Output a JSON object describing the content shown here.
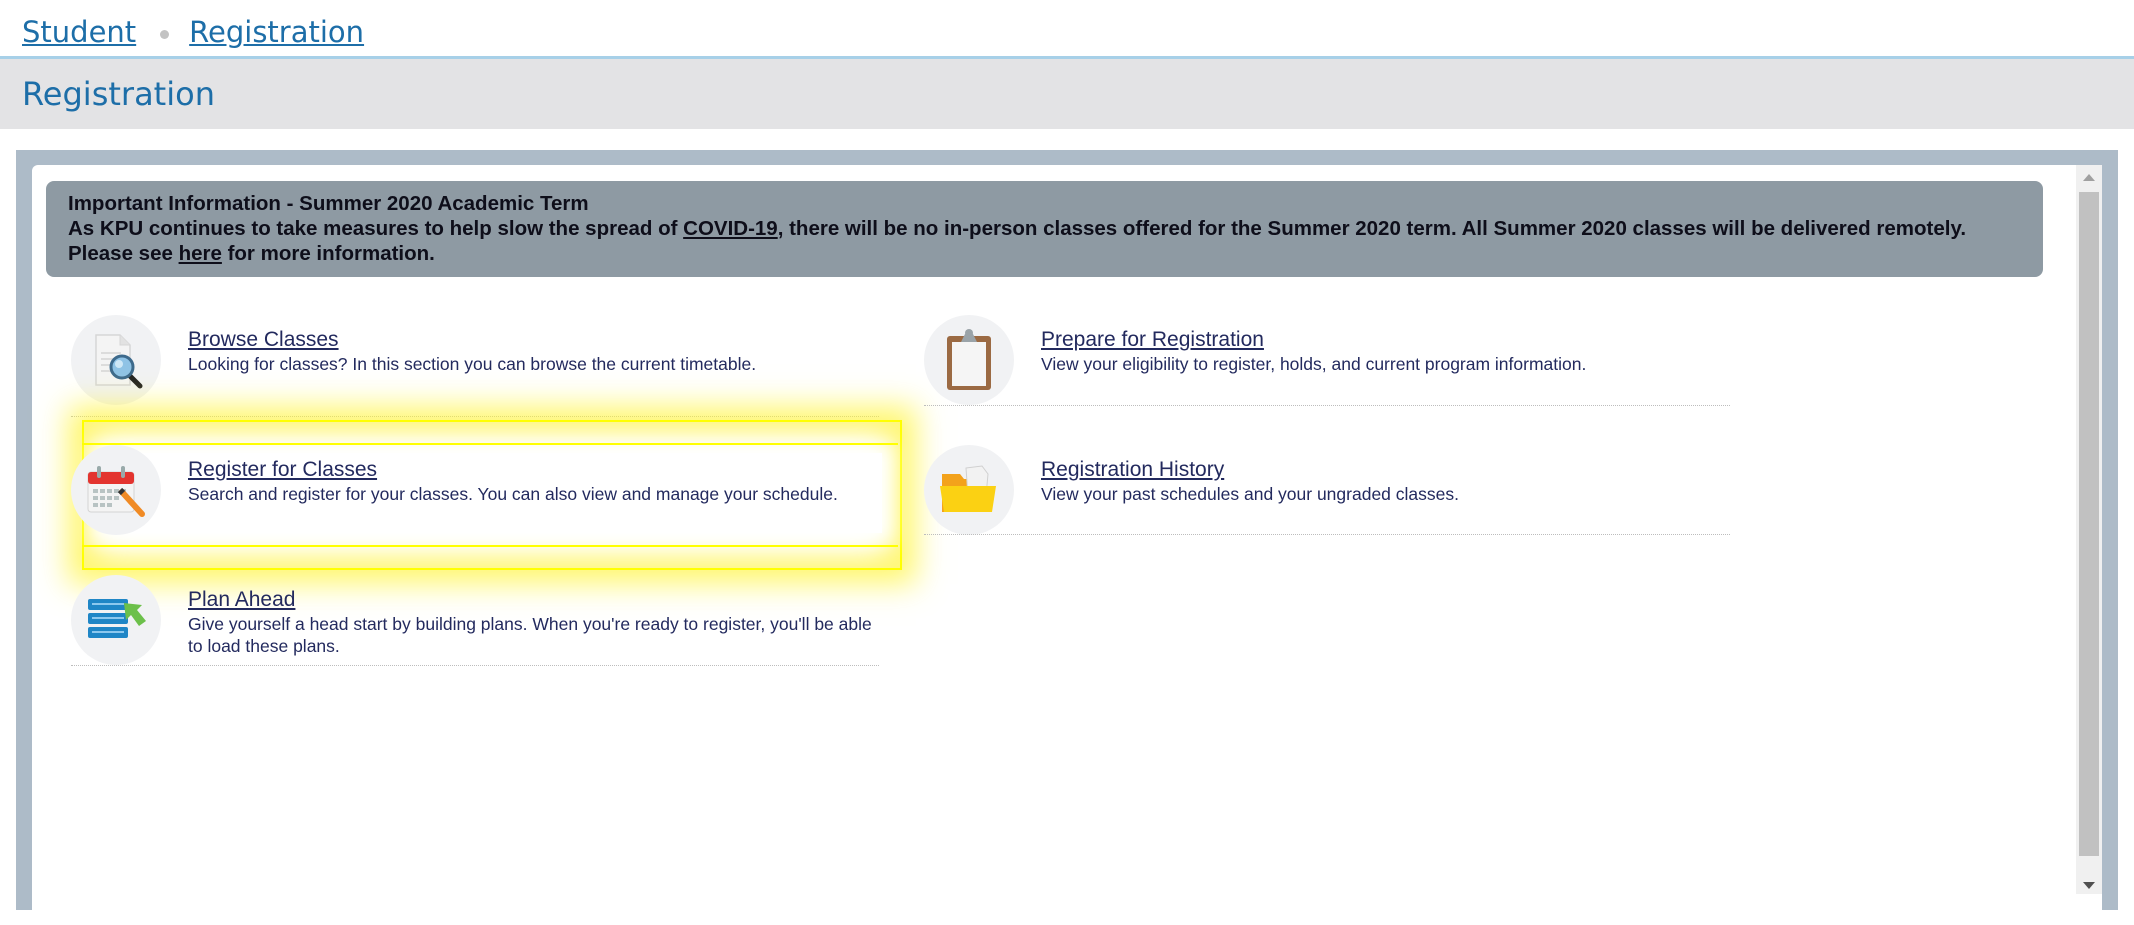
{
  "breadcrumb": {
    "items": [
      "Student",
      "Registration"
    ]
  },
  "header": {
    "title": "Registration"
  },
  "notice": {
    "heading": "Important Information - Summer 2020 Academic Term",
    "text_before_link": "As KPU continues to take measures to help slow the spread of ",
    "covid_link": "COVID-19",
    "text_after_link": ", there will be no in-person classes offered for the Summer 2020 term. All Summer 2020 classes will be delivered remotely. Please see ",
    "here_link": "here",
    "text_end": " for more information."
  },
  "menu": {
    "left": [
      {
        "title": "Browse Classes",
        "description": "Looking for classes? In this section you can browse the current timetable.",
        "icon": "browse-search-icon"
      },
      {
        "title": "Register for Classes",
        "description": "Search and register for your classes. You can also view and manage your schedule.",
        "icon": "calendar-pencil-icon",
        "highlighted": true
      },
      {
        "title": "Plan Ahead",
        "description": "Give yourself a head start by building plans. When you're ready to register, you'll be able to load these plans.",
        "icon": "plan-list-arrow-icon"
      }
    ],
    "right": [
      {
        "title": "Prepare for Registration",
        "description": "View your eligibility to register, holds, and current program information.",
        "icon": "clipboard-icon"
      },
      {
        "title": "Registration History",
        "description": "View your past schedules and your ungraded classes.",
        "icon": "folder-icon"
      }
    ]
  },
  "colors": {
    "link_blue": "#1d6ea8",
    "header_bg": "#e3e3e5",
    "notice_bg": "#8e9aa3",
    "panel_border": "#adbbc8",
    "highlight": "#ffff00"
  }
}
